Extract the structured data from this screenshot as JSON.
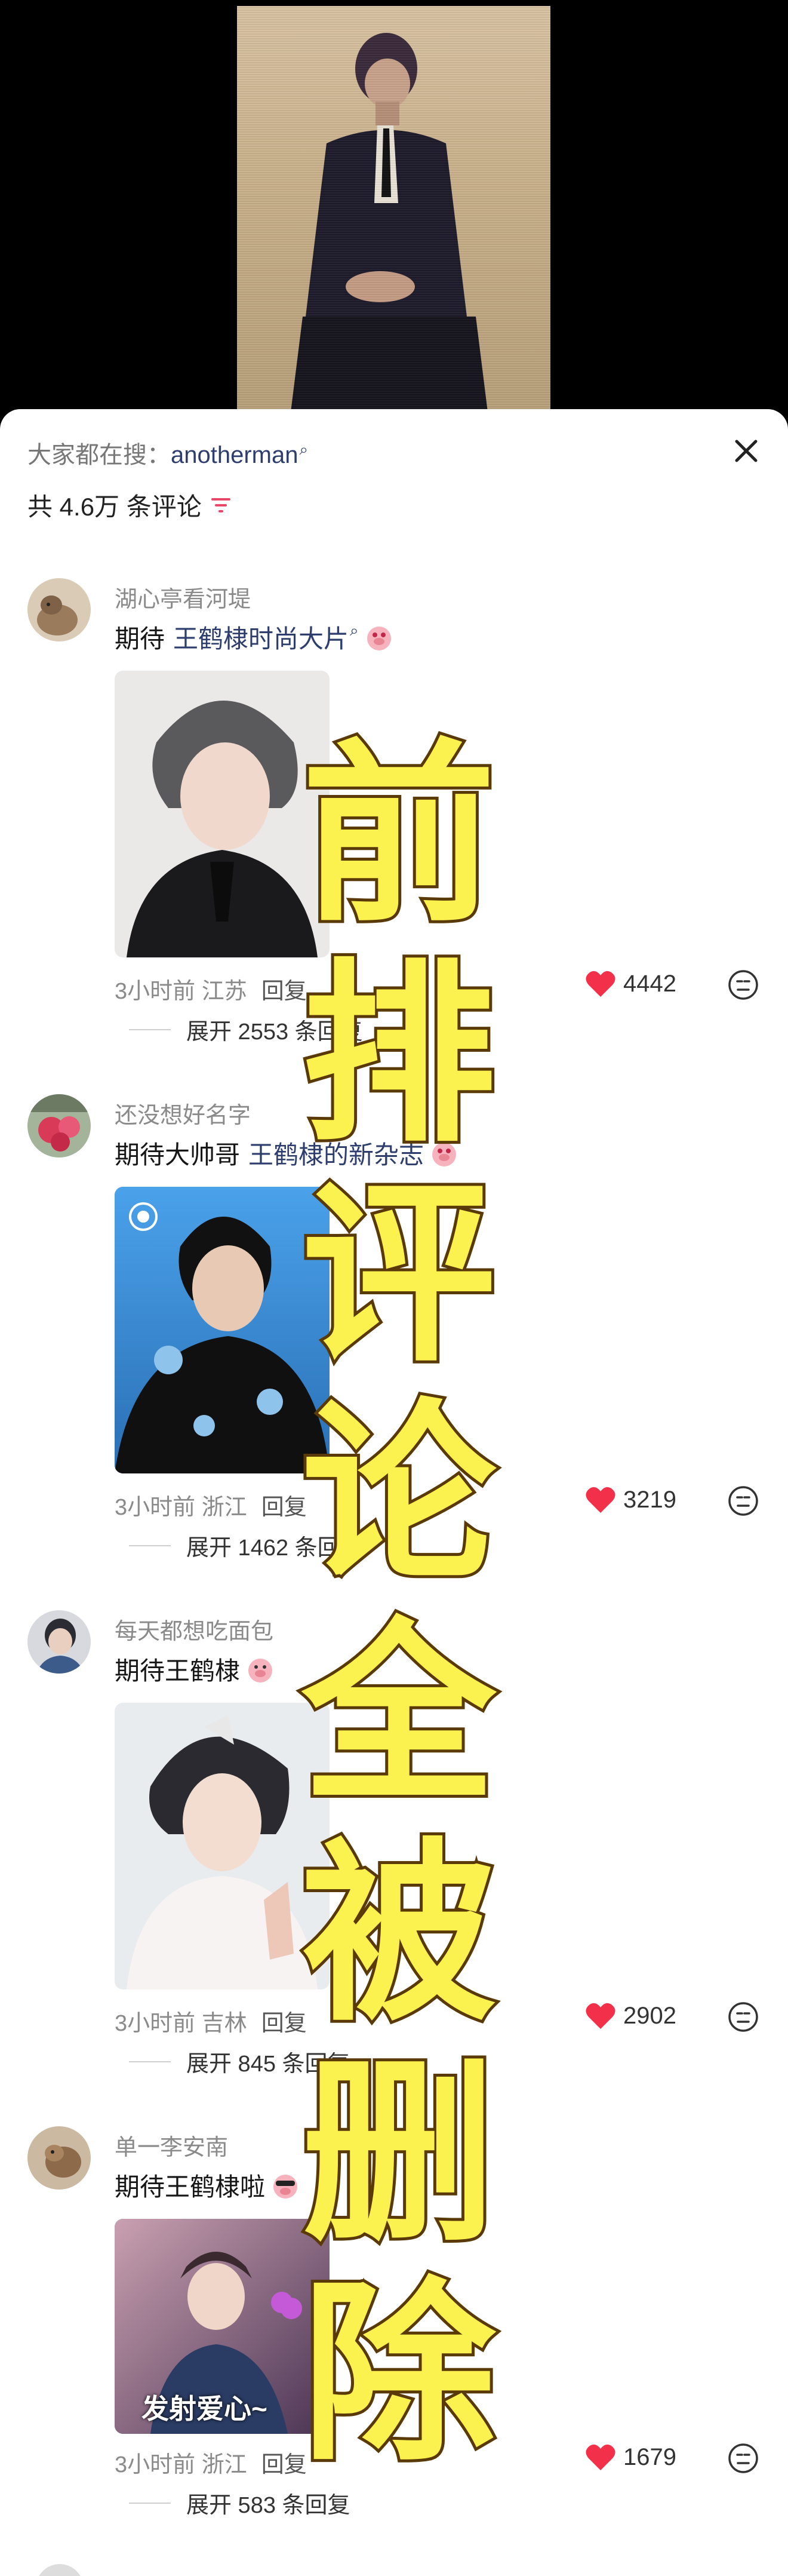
{
  "search": {
    "prefix": "大家都在搜：",
    "keyword": "anotherman",
    "keyword_icon": "search-icon"
  },
  "header": {
    "count_text": "共 4.6万 条评论",
    "filter_icon": "filter-icon",
    "close_icon": "close-icon"
  },
  "overlay_text": [
    "前",
    "排",
    "评",
    "论",
    "全",
    "被",
    "删",
    "除"
  ],
  "comments": [
    {
      "username": "湖心亭看河堤",
      "text_prefix": "期待 ",
      "text_highlight": "王鹤棣时尚大片",
      "sticker": "piggy-sticker",
      "time_location": "3小时前 江苏",
      "reply": "回复",
      "expand": "展开 2553 条回复",
      "likes": "4442"
    },
    {
      "username": "还没想好名字",
      "text_prefix": "期待大帅哥 ",
      "text_highlight": "王鹤棣的新杂志",
      "sticker": "piggy-sticker",
      "time_location": "3小时前 浙江",
      "reply": "回复",
      "expand": "展开 1462 条回复",
      "likes": "3219"
    },
    {
      "username": "每天都想吃面包",
      "text_prefix": "期待王鹤棣",
      "text_highlight": "",
      "sticker": "piggy-sticker",
      "time_location": "3小时前 吉林",
      "reply": "回复",
      "expand": "展开 845 条回复",
      "likes": "2902"
    },
    {
      "username": "单一李安南",
      "text_prefix": "期待王鹤棣啦",
      "text_highlight": "",
      "sticker": "piggy-sticker",
      "time_location": "3小时前 浙江",
      "reply": "回复",
      "expand": "展开 583 条回复",
      "likes": "1679",
      "image_caption": "发射爱心~"
    }
  ],
  "colors": {
    "like_red": "#f2304a",
    "highlight_blue": "#2d3d6e",
    "overlay_yellow": "#fbf250"
  }
}
